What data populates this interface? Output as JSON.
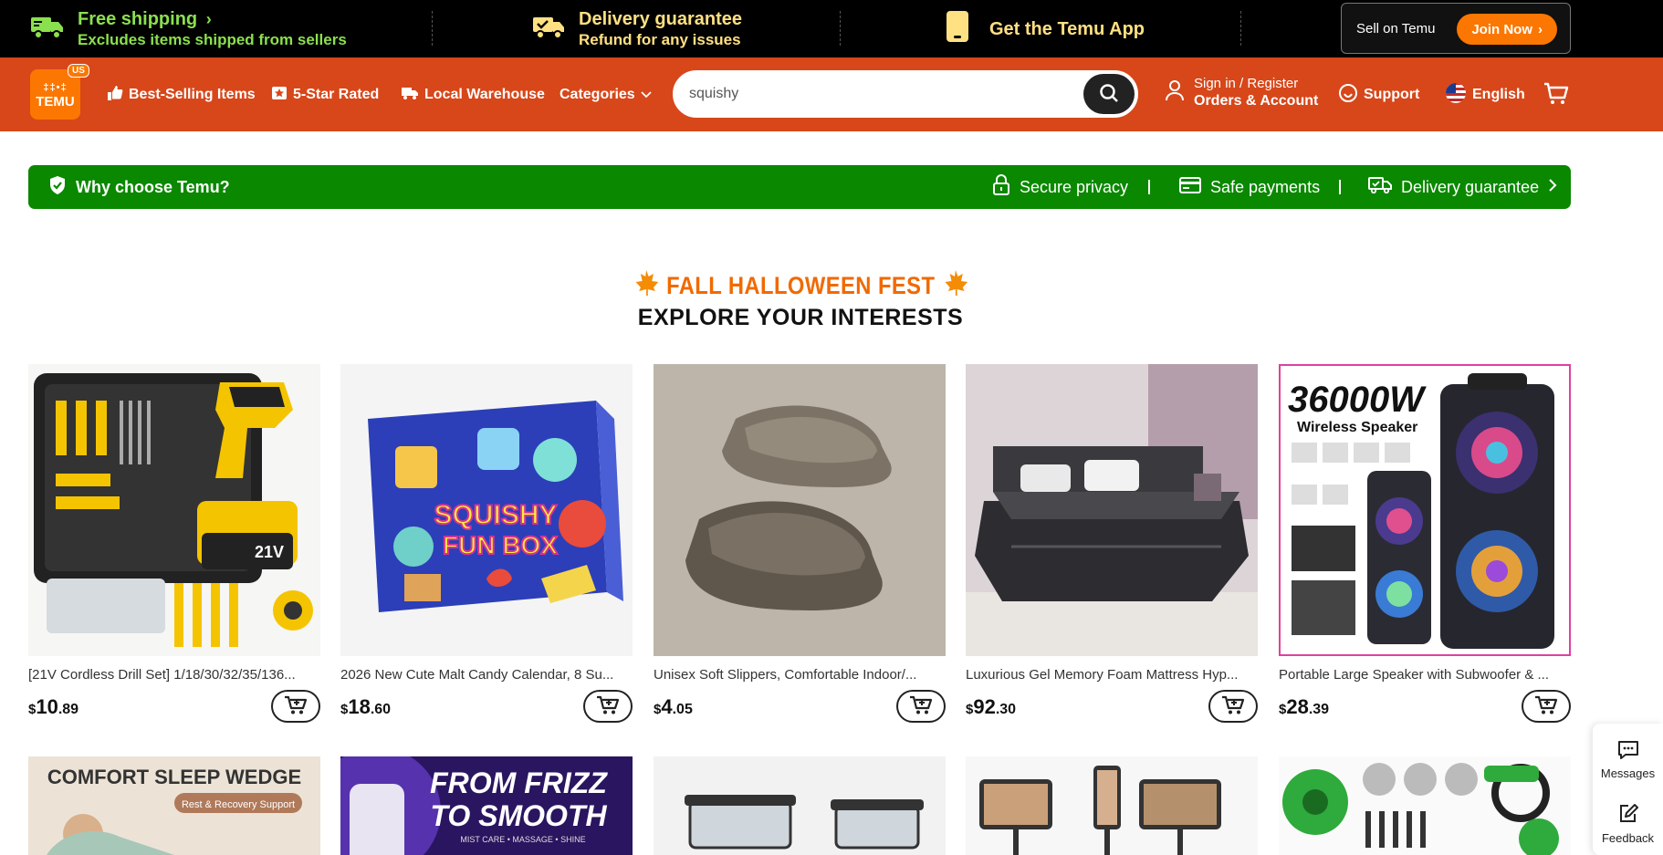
{
  "topbar": {
    "shipping_title": "Free shipping",
    "shipping_sub": "Excludes items shipped from sellers",
    "delivery_title": "Delivery guarantee",
    "delivery_sub": "Refund for any issues",
    "app_label": "Get the Temu App",
    "sell_label": "Sell on Temu",
    "join_label": "Join Now"
  },
  "header": {
    "logo_glyphs": "‡‡•‡",
    "logo_text": "TEMU",
    "region_badge": "US",
    "nav": {
      "best_selling": "Best-Selling Items",
      "five_star": "5-Star Rated",
      "local_warehouse": "Local Warehouse",
      "categories": "Categories"
    },
    "search": {
      "value": "squishy"
    },
    "account": {
      "line1": "Sign in / Register",
      "line2": "Orders & Account"
    },
    "support": "Support",
    "language": "English"
  },
  "why_bar": {
    "title": "Why choose Temu?",
    "secure_privacy": "Secure privacy",
    "safe_payments": "Safe payments",
    "delivery_guarantee": "Delivery guarantee"
  },
  "promo": {
    "title": "FALL HALLOWEEN FEST",
    "subtitle": "EXPLORE YOUR INTERESTS"
  },
  "products": [
    {
      "title": "[21V Cordless Drill Set] 1/18/30/32/35/136...",
      "currency": "$",
      "price_int": "10",
      "price_dec": ".89"
    },
    {
      "title": "2026 New Cute Malt Candy Calendar, 8 Su...",
      "currency": "$",
      "price_int": "18",
      "price_dec": ".60"
    },
    {
      "title": "Unisex Soft Slippers, Comfortable Indoor/...",
      "currency": "$",
      "price_int": "4",
      "price_dec": ".05"
    },
    {
      "title": "Luxurious Gel Memory Foam Mattress Hyp...",
      "currency": "$",
      "price_int": "92",
      "price_dec": ".30"
    },
    {
      "title": "Portable Large Speaker with Subwoofer & ...",
      "currency": "$",
      "price_int": "28",
      "price_dec": ".39"
    }
  ],
  "product_images": {
    "squishy_line1": "SQUISHY",
    "squishy_line2": "FUN BOX",
    "speaker_headline": "36000W",
    "speaker_sub": "Wireless Speaker",
    "wedge_headline": "COMFORT SLEEP WEDGE",
    "wedge_sub": "Rest & Recovery Support",
    "frizz_line1": "FROM FRIZZ",
    "frizz_line2": "TO SMOOTH",
    "frizz_sub": "MIST CARE • MASSAGE • SHINE",
    "drill_badge": "21V"
  },
  "side_widgets": {
    "messages": "Messages",
    "feedback": "Feedback"
  },
  "colors": {
    "header_orange": "#d7471a",
    "brand_orange": "#fb7701",
    "why_green": "#0a8800",
    "promo_orange": "#f06a00",
    "shipping_green": "#8be04e"
  }
}
